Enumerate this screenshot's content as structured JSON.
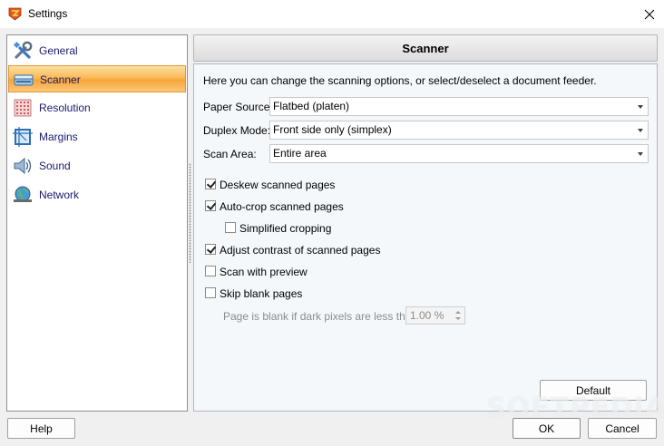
{
  "window": {
    "title": "Settings"
  },
  "sidebar": {
    "items": [
      {
        "label": "General",
        "icon": "tools-icon",
        "selected": false
      },
      {
        "label": "Scanner",
        "icon": "scanner-icon",
        "selected": true
      },
      {
        "label": "Resolution",
        "icon": "resolution-grid-icon",
        "selected": false
      },
      {
        "label": "Margins",
        "icon": "margins-icon",
        "selected": false
      },
      {
        "label": "Sound",
        "icon": "speaker-icon",
        "selected": false
      },
      {
        "label": "Network",
        "icon": "globe-network-icon",
        "selected": false
      }
    ]
  },
  "panel": {
    "title": "Scanner",
    "intro": "Here you can change the scanning options, or select/deselect a document feeder.",
    "paper_source": {
      "label": "Paper Source:",
      "value": "Flatbed (platen)"
    },
    "duplex_mode": {
      "label": "Duplex Mode:",
      "value": "Front side only (simplex)"
    },
    "scan_area": {
      "label": "Scan Area:",
      "value": "Entire area"
    },
    "options": {
      "deskew": {
        "label": "Deskew scanned pages",
        "checked": true
      },
      "autocrop": {
        "label": "Auto-crop scanned pages",
        "checked": true
      },
      "simplified": {
        "label": "Simplified cropping",
        "checked": false
      },
      "contrast": {
        "label": "Adjust contrast of scanned pages",
        "checked": true
      },
      "preview": {
        "label": "Scan with preview",
        "checked": false
      },
      "skip_blank": {
        "label": "Skip blank pages",
        "checked": false
      }
    },
    "blank_threshold": {
      "label": "Page is blank if dark pixels are less than:",
      "value": "1.00 %"
    },
    "default_label": "Default"
  },
  "footer": {
    "help_label": "Help",
    "ok_label": "OK",
    "cancel_label": "Cancel"
  },
  "watermark": "SOFTPEDIA",
  "colors": {
    "selected_start": "#fde0a0",
    "selected_end": "#f7a63a",
    "nav_text": "#1a1a6e"
  }
}
